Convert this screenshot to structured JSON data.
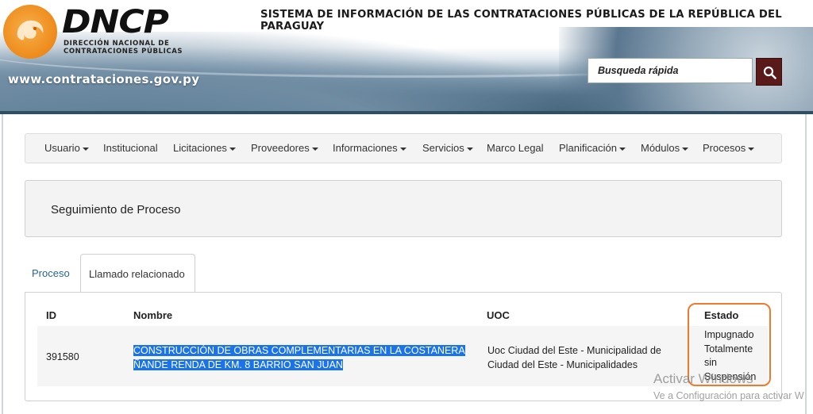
{
  "header": {
    "logo_title": "DNCP",
    "logo_sub_line1": "DIRECCIÓN NACIONAL DE",
    "logo_sub_line2": "CONTRATACIONES PÚBLICAS",
    "system_title": "SISTEMA DE INFORMACIÓN DE LAS CONTRATACIONES PÚBLICAS DE LA REPÚBLICA DEL PARAGUAY",
    "site_url": "www.contrataciones.gov.py",
    "search_placeholder": "Busqueda rápida"
  },
  "nav": {
    "items": [
      {
        "label": "Usuario",
        "dropdown": true
      },
      {
        "label": "Institucional",
        "dropdown": false
      },
      {
        "label": "Licitaciones",
        "dropdown": true
      },
      {
        "label": "Proveedores",
        "dropdown": true
      },
      {
        "label": "Informaciones",
        "dropdown": true
      },
      {
        "label": "Servicios",
        "dropdown": true
      },
      {
        "label": "Marco Legal",
        "dropdown": false
      },
      {
        "label": "Planificación",
        "dropdown": true
      },
      {
        "label": "Módulos",
        "dropdown": true
      },
      {
        "label": "Procesos",
        "dropdown": true
      }
    ]
  },
  "panel": {
    "title": "Seguimiento de Proceso"
  },
  "tabs": [
    {
      "label": "Proceso",
      "active": false
    },
    {
      "label": "Llamado relacionado",
      "active": true
    }
  ],
  "table": {
    "headers": [
      "ID",
      "Nombre",
      "UOC",
      "Estado"
    ],
    "rows": [
      {
        "id": "391580",
        "nombre_line1": "CONSTRUCCIÓN DE OBRAS COMPLEMENTARIAS EN LA COSTANERA",
        "nombre_line2": "ÑANDE RENDA DE KM. 8 BARRIO SAN JUAN",
        "uoc_line1": "Uoc Ciudad del Este - Municipalidad de",
        "uoc_line2": "Ciudad del Este - Municipalidades",
        "estado_line1": "Impugnado",
        "estado_line2": "Totalmente",
        "estado_line3": "sin",
        "estado_line4": "Suspensión"
      }
    ]
  },
  "watermark": {
    "line1": "Activar Windows",
    "line2": "Ve a Configuración para activar W"
  },
  "colors": {
    "accent_orange": "#ee7a2e",
    "link_blue": "#2a6496",
    "selection_blue": "#1a73e8",
    "search_button": "#5a1a1a"
  }
}
